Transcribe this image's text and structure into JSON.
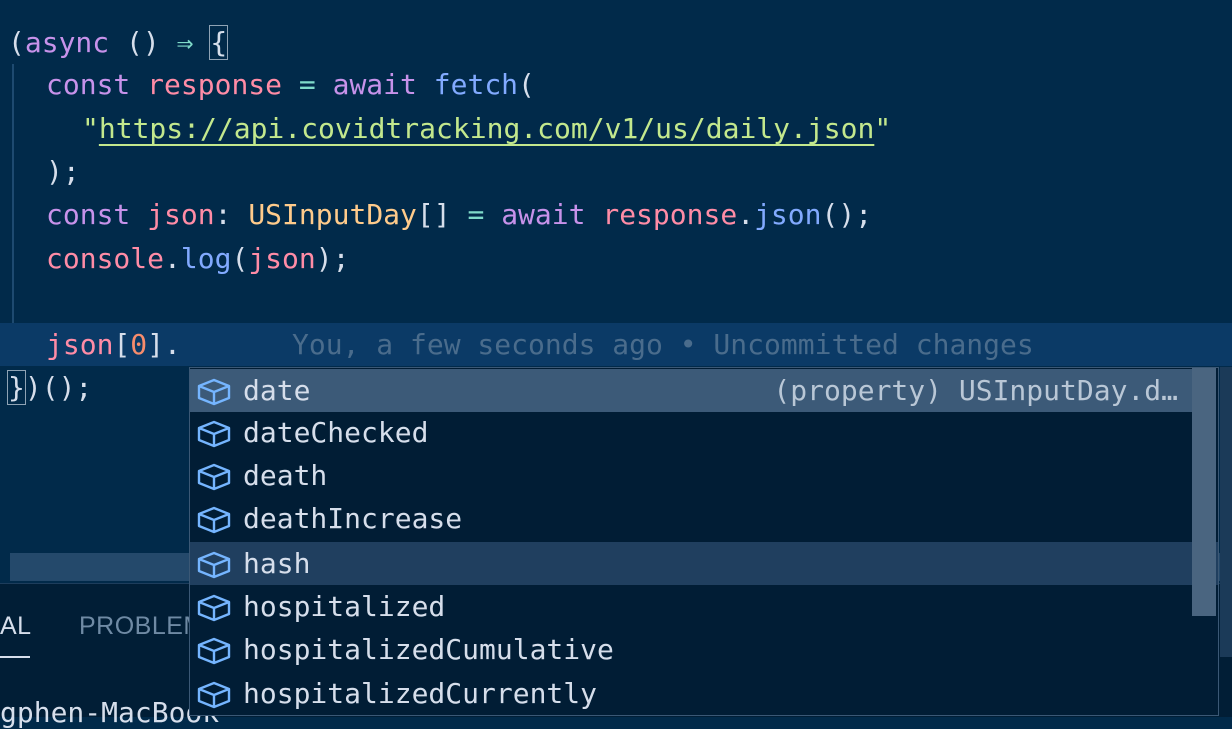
{
  "editor": {
    "lines": {
      "l1": {
        "open": "(",
        "async": "async",
        "parens": " () ",
        "arrow": "⇒",
        "space": " ",
        "brace": "{"
      },
      "l2": {
        "const": "const",
        "name": "response",
        "eq": " = ",
        "await": "await",
        "fetch": "fetch",
        "paren": "("
      },
      "l3": {
        "q1": "\"",
        "url": "https://api.covidtracking.com/v1/us/daily.json",
        "q2": "\""
      },
      "l4": {
        "text": ");"
      },
      "l5": {
        "const": "const",
        "name": "json",
        "colon": ": ",
        "type": "USInputDay",
        "arr": "[]",
        "eq": " = ",
        "await": "await",
        "obj": "response",
        "dot": ".",
        "method": "json",
        "end": "();"
      },
      "l6": {
        "obj": "console",
        "dot": ".",
        "method": "log",
        "p1": "(",
        "arg": "json",
        "end": ");"
      },
      "l8": {
        "obj": "json",
        "b1": "[",
        "idx": "0",
        "b2": "].",
        "blame": "You, a few seconds ago • Uncommitted changes"
      },
      "l9": {
        "brace": "}",
        "end": ")();"
      }
    }
  },
  "panel": {
    "tabs": [
      "AL",
      "PROBLEMS"
    ],
    "terminal_fragment": "gphen-MacBook"
  },
  "suggest": {
    "items": [
      {
        "label": "date",
        "detail": "(property) USInputDay.d…",
        "icon": "property-cube-icon"
      },
      {
        "label": "dateChecked",
        "icon": "property-cube-icon"
      },
      {
        "label": "death",
        "icon": "property-cube-icon"
      },
      {
        "label": "deathIncrease",
        "icon": "property-cube-icon"
      },
      {
        "label": "hash",
        "icon": "property-cube-icon"
      },
      {
        "label": "hospitalized",
        "icon": "property-cube-icon"
      },
      {
        "label": "hospitalizedCumulative",
        "icon": "property-cube-icon"
      },
      {
        "label": "hospitalizedCurrently",
        "icon": "property-cube-icon"
      }
    ]
  },
  "colors": {
    "background": "#012a4a",
    "keyword": "#c792ea",
    "variable": "#ff8ca6",
    "function": "#82aaff",
    "string": "#c3e88d",
    "type": "#ffcb8b",
    "icon": "#75b5ff"
  }
}
